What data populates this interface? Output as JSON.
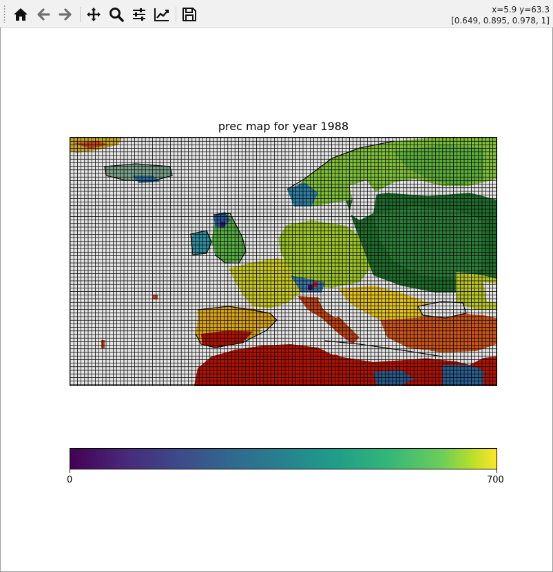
{
  "toolbar": {
    "buttons": [
      {
        "name": "home-icon",
        "icon": "home"
      },
      {
        "name": "back-icon",
        "icon": "arrow-left"
      },
      {
        "name": "forward-icon",
        "icon": "arrow-right"
      },
      {
        "name": "pan-icon",
        "icon": "move"
      },
      {
        "name": "zoom-icon",
        "icon": "magnifier"
      },
      {
        "name": "configure-subplots-icon",
        "icon": "sliders"
      },
      {
        "name": "edit-axis-icon",
        "icon": "line-chart"
      },
      {
        "name": "save-icon",
        "icon": "floppy-disk"
      }
    ],
    "coords_line1": "x=5.9 y=63.3",
    "coords_line2": "[0.649, 0.895, 0.978, 1]"
  },
  "plot": {
    "title": "prec map for year 1988"
  },
  "colorbar": {
    "min_label": "0",
    "max_label": "700",
    "min": 0,
    "max": 700,
    "colormap": "viridis"
  },
  "colors": {
    "grid_line": "#000000",
    "sea": "#e4e4e4",
    "dry": "#b31200",
    "wet": "#0a5a1e"
  }
}
